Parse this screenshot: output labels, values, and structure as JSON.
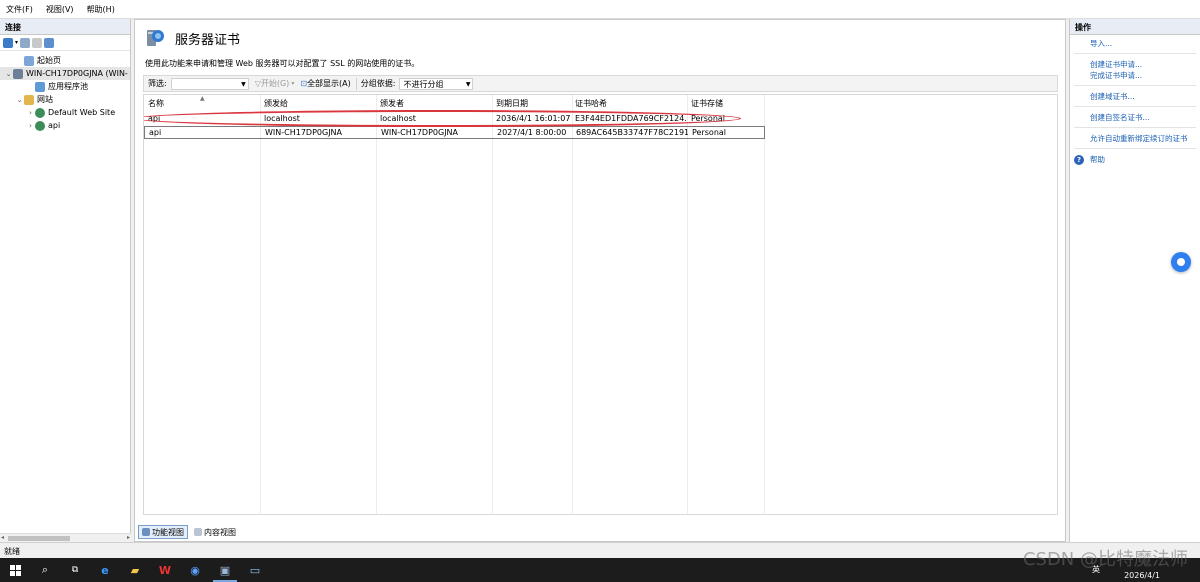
{
  "menu": [
    "文件(F)",
    "视图(V)",
    "帮助(H)"
  ],
  "left_pane": {
    "title": "连接",
    "tree": [
      {
        "label": "起始页",
        "indent": 1,
        "icon": "start-page-icon",
        "chev": ""
      },
      {
        "label": "WIN-CH17DP0GJNA (WIN-",
        "indent": 0,
        "icon": "server-icon",
        "chev": "v",
        "selected": true
      },
      {
        "label": "应用程序池",
        "indent": 2,
        "icon": "app-pool-icon",
        "chev": ""
      },
      {
        "label": "网站",
        "indent": 1,
        "icon": "sites-folder-icon",
        "chev": "v"
      },
      {
        "label": "Default Web Site",
        "indent": 2,
        "icon": "globe-icon",
        "chev": ">"
      },
      {
        "label": "api",
        "indent": 2,
        "icon": "globe-icon",
        "chev": ">"
      }
    ]
  },
  "center": {
    "title": "服务器证书",
    "description": "使用此功能来申请和管理 Web 服务器可以对配置了 SSL 的网站使用的证书。",
    "filter_label": "筛选:",
    "filter_value": "",
    "start_label": "开始(G)",
    "show_all_label": "全部显示(A)",
    "group_label": "分组依据:",
    "group_value": "不进行分组",
    "columns": [
      "名称",
      "颁发给",
      "颁发者",
      "到期日期",
      "证书哈希",
      "证书存储"
    ],
    "rows": [
      [
        "api",
        "localhost",
        "localhost",
        "2036/4/1 16:01:07",
        "E3F44ED1FDDA769CF2124...",
        "Personal"
      ],
      [
        "api",
        "WIN-CH17DP0GJNA",
        "WIN-CH17DP0GJNA",
        "2027/4/1 8:00:00",
        "689AC645B33747F78C2191...",
        "Personal"
      ]
    ],
    "tabs": [
      "功能视图",
      "内容视图"
    ]
  },
  "right_pane": {
    "title": "操作",
    "actions_groups": [
      [
        "导入..."
      ],
      [
        "创建证书申请...",
        "完成证书申请..."
      ],
      [
        "创建域证书..."
      ],
      [
        "创建自签名证书..."
      ],
      [
        "允许自动重新绑定续订的证书"
      ]
    ],
    "help": "帮助"
  },
  "status": "就绪",
  "watermark": "CSDN @比特魔法师",
  "tray": {
    "lang": "英",
    "date": "2026/4/1"
  },
  "colors": {
    "accent": "#1a5fb4",
    "highlight": "#d9363e",
    "taskbar": "#1c1c1c"
  }
}
